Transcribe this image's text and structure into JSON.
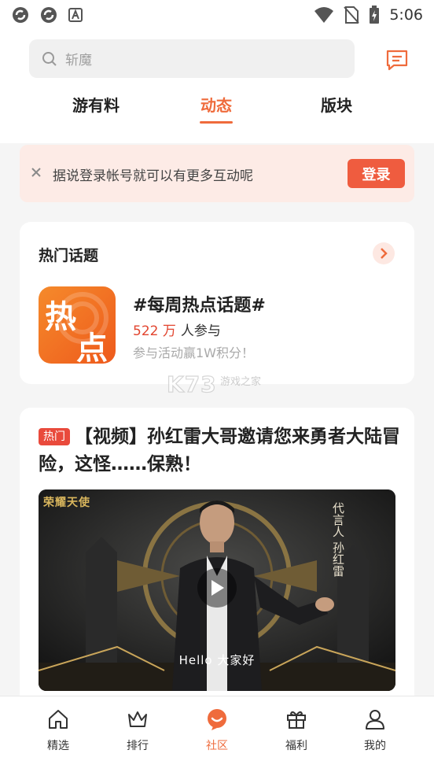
{
  "status_bar": {
    "time": "5:06",
    "icons": [
      "sync-icon",
      "sync-icon",
      "app-notification-icon",
      "wifi-icon",
      "no-sim-icon",
      "battery-charging-icon"
    ]
  },
  "search": {
    "placeholder": "斩魔",
    "icon": "search-icon"
  },
  "message_button": {
    "icon": "message-icon"
  },
  "tabs": [
    {
      "label": "游有料",
      "active": false
    },
    {
      "label": "动态",
      "active": true
    },
    {
      "label": "版块",
      "active": false
    }
  ],
  "login_banner": {
    "text": "据说登录帐号就可以有更多互动呢",
    "button_label": "登录"
  },
  "hot_topics": {
    "title": "热门话题",
    "topic": {
      "icon_text_1": "热",
      "icon_text_2": "点",
      "name": "#每周热点话题#",
      "count": "522 万",
      "count_suffix": "人参与",
      "subtitle": "参与活动赢1W积分！"
    }
  },
  "watermark": {
    "text": "K73",
    "subtext": "游戏之家"
  },
  "post": {
    "tag": "热门",
    "title": "【视频】孙红雷大哥邀请您来勇者大陆冒险，这怪……保熟！",
    "video": {
      "logo": "荣耀天使",
      "side_text": "代言人 孙红雷",
      "caption": "Hello  大家好"
    }
  },
  "bottom_nav": [
    {
      "label": "精选",
      "icon": "home-icon",
      "active": false
    },
    {
      "label": "排行",
      "icon": "crown-icon",
      "active": false
    },
    {
      "label": "社区",
      "icon": "community-icon",
      "active": true
    },
    {
      "label": "福利",
      "icon": "gift-icon",
      "active": false
    },
    {
      "label": "我的",
      "icon": "profile-icon",
      "active": false
    }
  ],
  "colors": {
    "accent": "#ef6b3c",
    "login_button": "#ef5c3f",
    "banner_bg": "#fdebe6",
    "hot_tag": "#e94a3c"
  }
}
